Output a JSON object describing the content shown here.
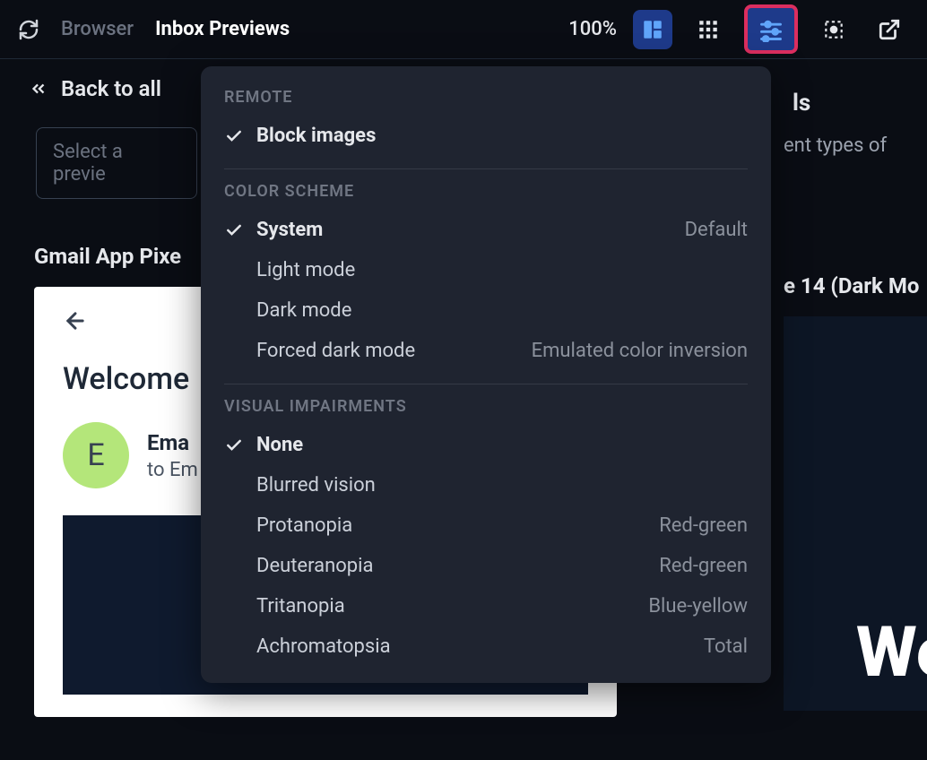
{
  "topbar": {
    "tab_browser": "Browser",
    "tab_inbox": "Inbox Previews",
    "zoom": "100%"
  },
  "subbar": {
    "back": "Back to all",
    "select_placeholder": "Select a previe"
  },
  "preview": {
    "title_left": "Gmail App Pixe",
    "card_welcome": "Welcome",
    "sender_initial": "E",
    "sender_name": "Ema",
    "sender_to": "to Em"
  },
  "right": {
    "heading_frag": "ls",
    "desc_frag": "ent types of",
    "tab_frag": "e 14 (Dark Mo",
    "big_text": "We"
  },
  "panel": {
    "remote": {
      "label": "REMOTE",
      "block_images": "Block images"
    },
    "colorscheme": {
      "label": "COLOR SCHEME",
      "system": "System",
      "system_hint": "Default",
      "light": "Light mode",
      "dark": "Dark mode",
      "forced": "Forced dark mode",
      "forced_hint": "Emulated color inversion"
    },
    "visual": {
      "label": "VISUAL IMPAIRMENTS",
      "none": "None",
      "blurred": "Blurred vision",
      "protanopia": "Protanopia",
      "protanopia_hint": "Red-green",
      "deuteranopia": "Deuteranopia",
      "deuteranopia_hint": "Red-green",
      "tritanopia": "Tritanopia",
      "tritanopia_hint": "Blue-yellow",
      "achromatopsia": "Achromatopsia",
      "achromatopsia_hint": "Total"
    }
  }
}
